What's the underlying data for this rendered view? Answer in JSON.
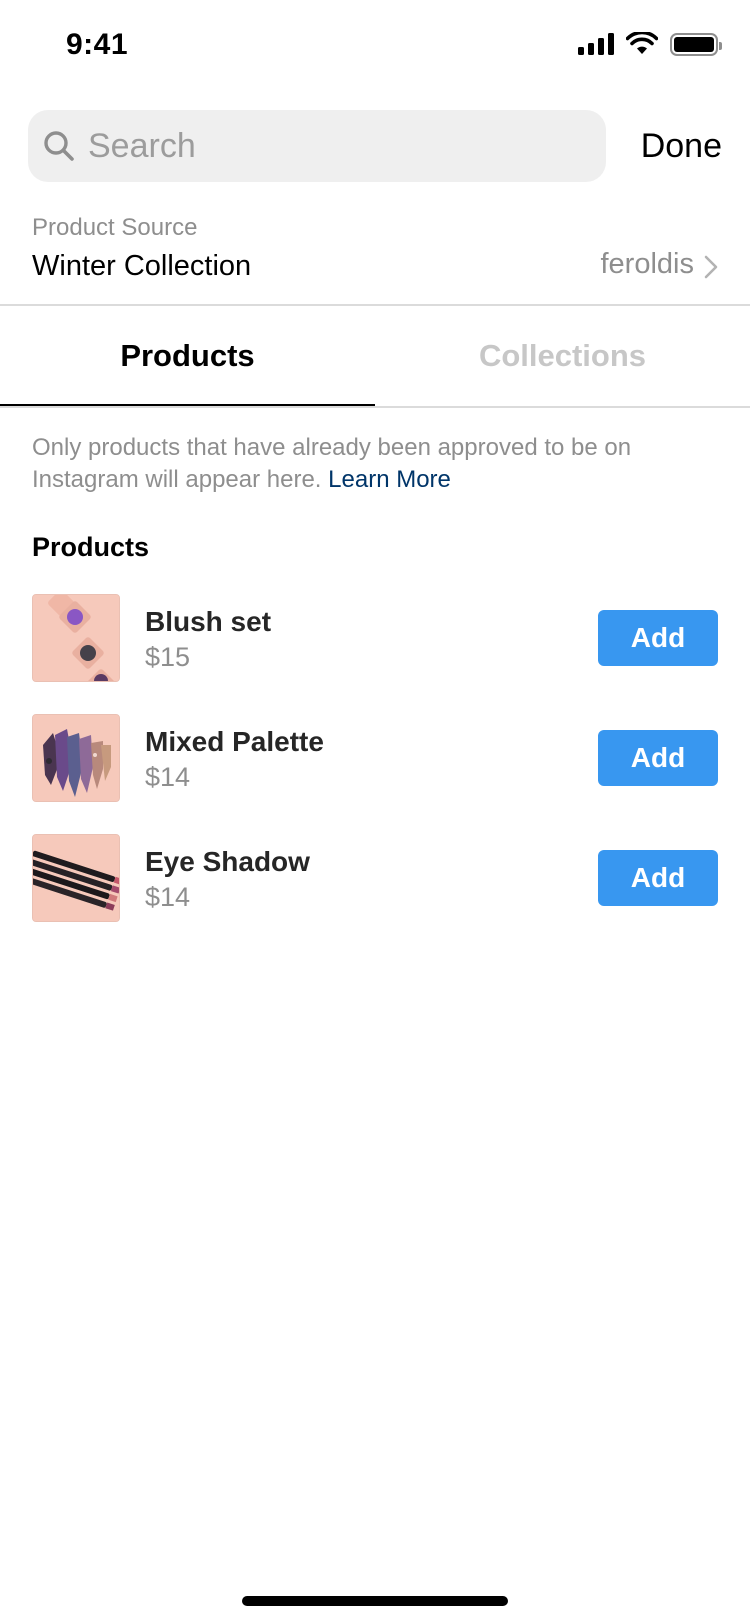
{
  "status_bar": {
    "time": "9:41",
    "icons": [
      "signal-icon",
      "wifi-icon",
      "battery-icon"
    ]
  },
  "search": {
    "placeholder": "Search",
    "value": "",
    "done_label": "Done"
  },
  "product_source": {
    "caption": "Product Source",
    "value": "Winter Collection",
    "account": "feroldis"
  },
  "tabs": [
    {
      "label": "Products",
      "active": true
    },
    {
      "label": "Collections",
      "active": false
    }
  ],
  "info": {
    "text": "Only products that have already been approved to be on Instagram will appear here.",
    "link": "Learn More"
  },
  "section_title": "Products",
  "products": [
    {
      "name": "Blush set",
      "price": "$15",
      "action": "Add",
      "thumb_icon": "blush-set-thumbnail"
    },
    {
      "name": "Mixed Palette",
      "price": "$14",
      "action": "Add",
      "thumb_icon": "mixed-palette-thumbnail"
    },
    {
      "name": "Eye Shadow",
      "price": "$14",
      "action": "Add",
      "thumb_icon": "eye-shadow-thumbnail"
    }
  ],
  "colors": {
    "accent": "#3897f0",
    "link": "#003569",
    "muted_text": "#8e8e8e",
    "search_bg": "#efefef",
    "thumb_bg": "#f6c9bb"
  }
}
